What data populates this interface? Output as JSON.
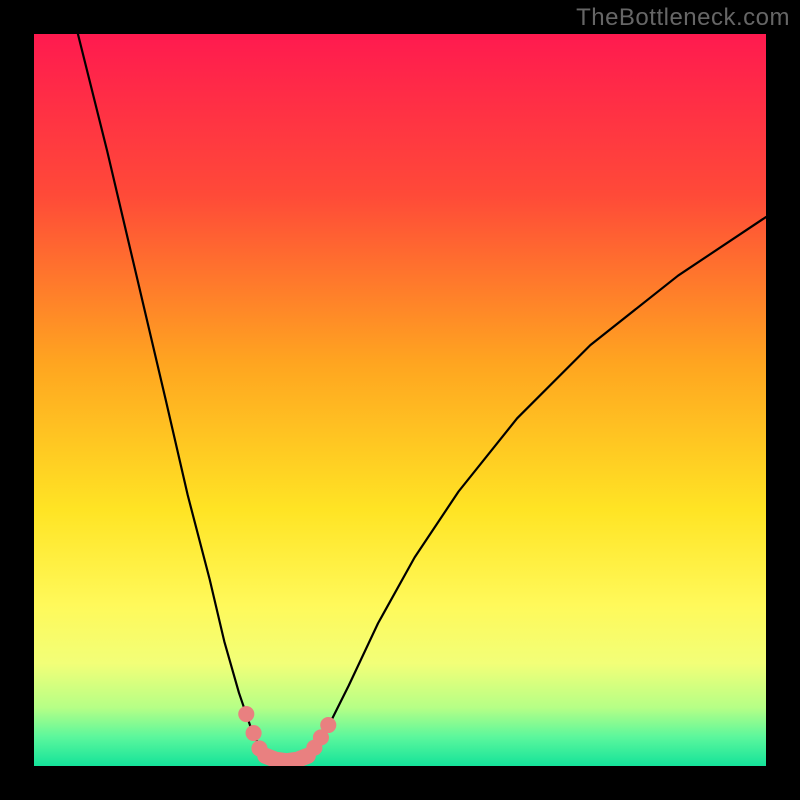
{
  "watermark": "TheBottleneck.com",
  "chart_data": {
    "type": "line",
    "title": "",
    "xlabel": "",
    "ylabel": "",
    "xlim": [
      0,
      100
    ],
    "ylim": [
      0,
      100
    ],
    "grid": false,
    "legend": false,
    "background_gradient": [
      {
        "pos": 0.0,
        "color": "#ff1a4f"
      },
      {
        "pos": 0.22,
        "color": "#ff4a38"
      },
      {
        "pos": 0.45,
        "color": "#ffa520"
      },
      {
        "pos": 0.65,
        "color": "#ffe424"
      },
      {
        "pos": 0.78,
        "color": "#fff95a"
      },
      {
        "pos": 0.86,
        "color": "#f2ff78"
      },
      {
        "pos": 0.92,
        "color": "#b6ff86"
      },
      {
        "pos": 0.96,
        "color": "#5cf79c"
      },
      {
        "pos": 1.0,
        "color": "#14e39a"
      }
    ],
    "series": [
      {
        "name": "left-branch",
        "color": "#000000",
        "x": [
          6,
          10,
          14,
          18,
          21,
          24,
          26,
          28,
          29.5,
          30.5,
          31.2,
          31.8
        ],
        "y": [
          100,
          84,
          67,
          50,
          37,
          25.5,
          17,
          10,
          5.6,
          3.3,
          1.9,
          1.2
        ]
      },
      {
        "name": "right-branch",
        "color": "#000000",
        "x": [
          37.2,
          38,
          39,
          40.5,
          43,
          47,
          52,
          58,
          66,
          76,
          88,
          100
        ],
        "y": [
          1.2,
          2.0,
          3.4,
          6.0,
          11,
          19.5,
          28.5,
          37.5,
          47.5,
          57.5,
          67,
          75
        ]
      },
      {
        "name": "valley-floor",
        "color": "#000000",
        "x": [
          31.8,
          33,
          34.5,
          36,
          37.2
        ],
        "y": [
          1.2,
          0.7,
          0.5,
          0.7,
          1.2
        ]
      }
    ],
    "markers": {
      "name": "highlight-dots",
      "color": "#e98080",
      "radius": 1.1,
      "points": [
        {
          "x": 29.0,
          "y": 7.1
        },
        {
          "x": 30.0,
          "y": 4.5
        },
        {
          "x": 30.8,
          "y": 2.4
        },
        {
          "x": 38.3,
          "y": 2.5
        },
        {
          "x": 39.2,
          "y": 3.9
        },
        {
          "x": 40.2,
          "y": 5.6
        }
      ]
    },
    "valley_stroke": {
      "name": "valley-pink-segment",
      "color": "#e98080",
      "width": 2.2,
      "x": [
        31.6,
        33,
        34.5,
        36,
        37.4
      ],
      "y": [
        1.4,
        0.85,
        0.65,
        0.85,
        1.4
      ]
    }
  }
}
